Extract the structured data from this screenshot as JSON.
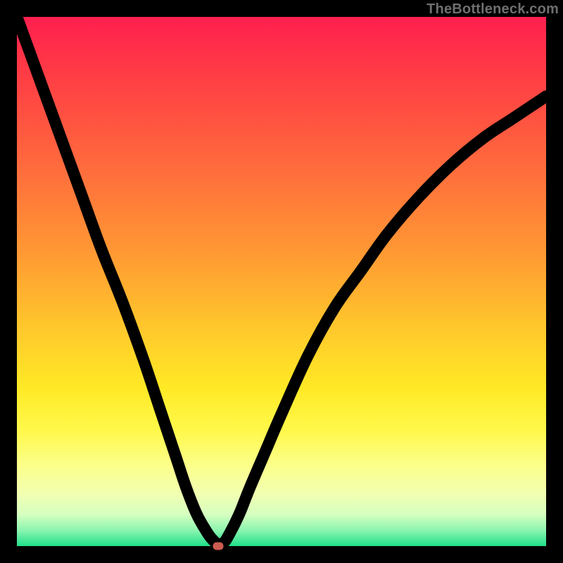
{
  "watermark": "TheBottleneck.com",
  "chart_data": {
    "type": "line",
    "title": "",
    "xlabel": "",
    "ylabel": "",
    "xlim": [
      0,
      100
    ],
    "ylim": [
      0,
      100
    ],
    "x": [
      0,
      4,
      8,
      12,
      16,
      20,
      24,
      27,
      30,
      32,
      34,
      36,
      37,
      38,
      39,
      40,
      42,
      44,
      47,
      50,
      55,
      60,
      65,
      70,
      76,
      82,
      88,
      94,
      100
    ],
    "values": [
      100,
      89,
      78,
      67,
      56,
      46,
      35,
      26,
      17,
      11,
      6,
      2.5,
      1.2,
      0.4,
      0.6,
      2,
      6,
      11,
      18,
      25,
      36,
      45,
      52,
      59,
      66,
      72,
      77,
      81,
      85
    ],
    "marker": {
      "x": 38,
      "y": 0
    },
    "grid": false,
    "legend": false
  },
  "colors": {
    "gradient_top": "#ff1f4e",
    "gradient_mid": "#ffe925",
    "gradient_bottom": "#1fe08a",
    "curve": "#000000",
    "marker": "#cc5b50",
    "watermark": "#6f6f6f"
  }
}
